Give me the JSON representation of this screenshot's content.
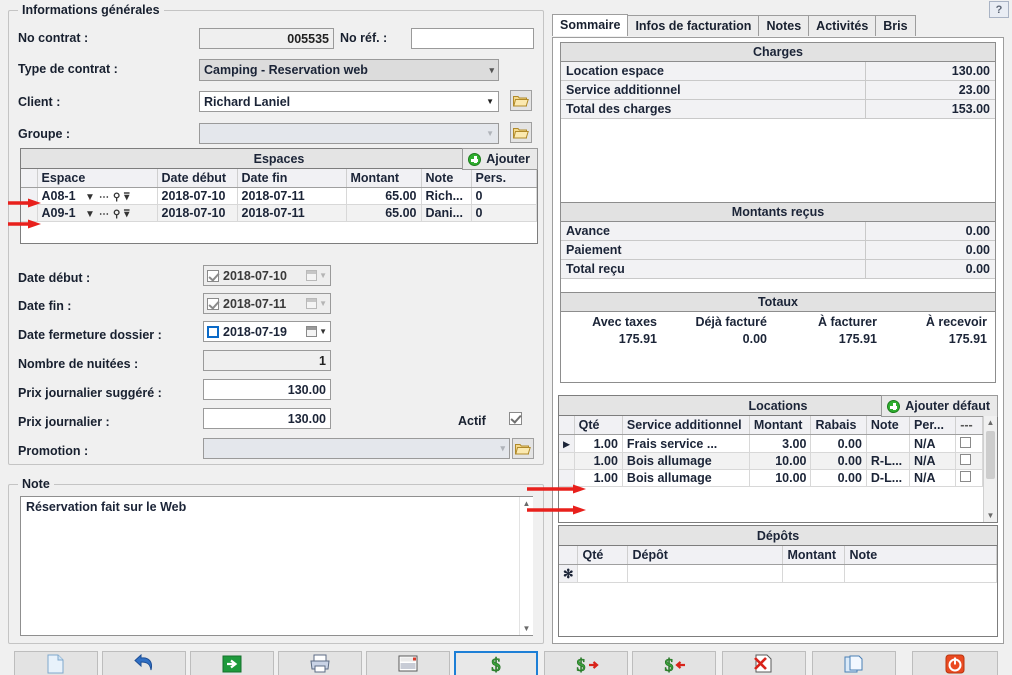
{
  "window": {
    "help_label": "?"
  },
  "general": {
    "title": "Informations générales",
    "no_contrat_label": "No contrat :",
    "no_contrat_value": "005535",
    "no_ref_label": "No réf. :",
    "no_ref_value": "",
    "type_contrat_label": "Type de contrat :",
    "type_contrat_value": "Camping - Reservation web",
    "client_label": "Client :",
    "client_value": "Richard Laniel",
    "groupe_label": "Groupe :",
    "groupe_value": ""
  },
  "espaces": {
    "caption": "Espaces",
    "add_label": "Ajouter",
    "columns": [
      "Espace",
      "Date début",
      "Date fin",
      "Montant",
      "Note",
      "Pers."
    ],
    "rows": [
      {
        "espace": "A08-1",
        "date_debut": "2018-07-10",
        "date_fin": "2018-07-11",
        "montant": "65.00",
        "note": "Rich...",
        "pers": "0"
      },
      {
        "espace": "A09-1",
        "date_debut": "2018-07-10",
        "date_fin": "2018-07-11",
        "montant": "65.00",
        "note": "Dani...",
        "pers": "0"
      }
    ]
  },
  "dates": {
    "date_debut_label": "Date début :",
    "date_debut_value": "2018-07-10",
    "date_fin_label": "Date fin :",
    "date_fin_value": "2018-07-11",
    "date_fermeture_label": "Date fermeture dossier :",
    "date_fermeture_value": "2018-07-19",
    "nuitees_label": "Nombre de nuitées :",
    "nuitees_value": "1",
    "prix_suggere_label": "Prix journalier suggéré :",
    "prix_suggere_value": "130.00",
    "prix_label": "Prix journalier :",
    "prix_value": "130.00",
    "actif_label": "Actif",
    "promotion_label": "Promotion :",
    "promotion_value": ""
  },
  "note": {
    "title": "Note",
    "text": "Réservation fait sur le Web"
  },
  "tabs": [
    {
      "label": "Sommaire",
      "active": true
    },
    {
      "label": "Infos de facturation",
      "active": false
    },
    {
      "label": "Notes",
      "active": false
    },
    {
      "label": "Activités",
      "active": false
    },
    {
      "label": "Bris",
      "active": false
    }
  ],
  "charges": {
    "caption": "Charges",
    "rows": [
      {
        "label": "Location espace",
        "value": "130.00"
      },
      {
        "label": "Service additionnel",
        "value": "23.00"
      },
      {
        "label": "Total des charges",
        "value": "153.00"
      }
    ]
  },
  "montants_recus": {
    "caption": "Montants reçus",
    "rows": [
      {
        "label": "Avance",
        "value": "0.00"
      },
      {
        "label": "Paiement",
        "value": "0.00"
      },
      {
        "label": "Total reçu",
        "value": "0.00"
      }
    ]
  },
  "totaux": {
    "caption": "Totaux",
    "columns": [
      "Avec taxes",
      "Déjà facturé",
      "À facturer",
      "À recevoir"
    ],
    "values": [
      "175.91",
      "0.00",
      "175.91",
      "175.91"
    ]
  },
  "locations": {
    "caption": "Locations",
    "add_label": "Ajouter défaut",
    "columns": [
      "Qté",
      "Service additionnel",
      "Montant",
      "Rabais",
      "Note",
      "Per...",
      "---"
    ],
    "rows": [
      {
        "marker": "▸",
        "qte": "1.00",
        "service": "Frais service ...",
        "montant": "3.00",
        "rabais": "0.00",
        "note": "",
        "per": "N/A"
      },
      {
        "marker": "",
        "qte": "1.00",
        "service": "Bois allumage",
        "montant": "10.00",
        "rabais": "0.00",
        "note": "R-L...",
        "per": "N/A"
      },
      {
        "marker": "",
        "qte": "1.00",
        "service": "Bois allumage",
        "montant": "10.00",
        "rabais": "0.00",
        "note": "D-L...",
        "per": "N/A"
      }
    ]
  },
  "depots": {
    "caption": "Dépôts",
    "columns": [
      "Qté",
      "Dépôt",
      "Montant",
      "Note"
    ],
    "new_row_marker": "✻"
  },
  "toolbar": {
    "buttons": [
      {
        "name": "new-document",
        "icon": "page-icon"
      },
      {
        "name": "undo",
        "icon": "undo-icon"
      },
      {
        "name": "save-export",
        "icon": "green-arrow-icon"
      },
      {
        "name": "print",
        "icon": "printer-icon"
      },
      {
        "name": "report",
        "icon": "report-icon"
      },
      {
        "name": "invoice",
        "icon": "dollar-icon"
      },
      {
        "name": "payment-out",
        "icon": "dollar-right-icon"
      },
      {
        "name": "payment-in",
        "icon": "dollar-left-icon"
      },
      {
        "name": "cancel-invoice",
        "icon": "delete-document-icon"
      },
      {
        "name": "duplicate",
        "icon": "copy-icon"
      },
      {
        "name": "close",
        "icon": "power-icon"
      }
    ]
  },
  "colors": {
    "accent": "#1d7fd6",
    "arrow": "#e8201c",
    "green": "#2fae2f",
    "background": "#f0f0f0"
  }
}
